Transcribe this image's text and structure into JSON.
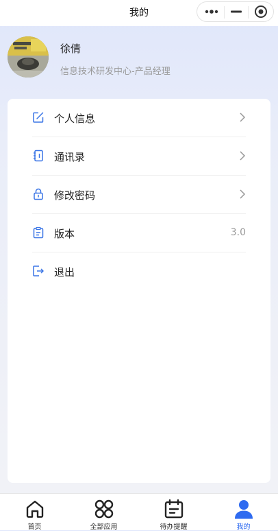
{
  "header": {
    "title": "我的"
  },
  "capsule": {
    "more_icon": "more-dots-icon",
    "minimize_icon": "minimize-icon",
    "close_icon": "target-close-icon"
  },
  "profile": {
    "name": "徐倩",
    "department": "信息技术研发中心-产品经理",
    "avatar_icon": "user-avatar-photo"
  },
  "menu": [
    {
      "label": "个人信息",
      "icon": "edit-square-icon",
      "chevron": true
    },
    {
      "label": "通讯录",
      "icon": "address-book-icon",
      "chevron": true
    },
    {
      "label": "修改密码",
      "icon": "lock-icon",
      "chevron": true
    },
    {
      "label": "版本",
      "icon": "clipboard-icon",
      "value": "3.0"
    },
    {
      "label": "退出",
      "icon": "logout-icon"
    }
  ],
  "tabs": [
    {
      "label": "首页",
      "icon": "home-icon",
      "active": false
    },
    {
      "label": "全部应用",
      "icon": "apps-grid-icon",
      "active": false
    },
    {
      "label": "待办提醒",
      "icon": "calendar-todo-icon",
      "active": false
    },
    {
      "label": "我的",
      "icon": "person-icon",
      "active": true
    }
  ],
  "colors": {
    "accent": "#2f6bf0",
    "menu_icon": "#3a75e6",
    "text_secondary": "#9a9a9a",
    "header_gradient": "#dfe6fb"
  }
}
